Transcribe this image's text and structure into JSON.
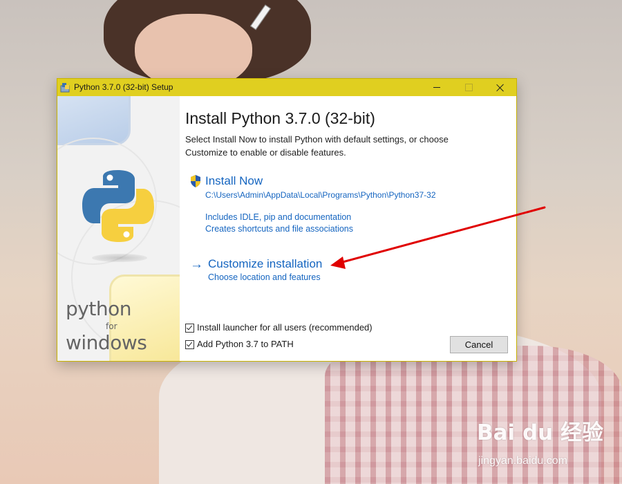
{
  "window": {
    "title": "Python 3.7.0 (32-bit) Setup"
  },
  "sidebar": {
    "brand_python": "python",
    "brand_for": "for",
    "brand_windows": "windows"
  },
  "main": {
    "heading": "Install Python 3.7.0 (32-bit)",
    "subtext_line1": "Select Install Now to install Python with default settings, or choose",
    "subtext_line2": "Customize to enable or disable features."
  },
  "install_now": {
    "label": "Install Now",
    "path": "C:\\Users\\Admin\\AppData\\Local\\Programs\\Python\\Python37-32",
    "detail1": "Includes IDLE, pip and documentation",
    "detail2": "Creates shortcuts and file associations"
  },
  "customize": {
    "label": "Customize installation",
    "detail": "Choose location and features"
  },
  "options": {
    "launcher_label": "Install launcher for all users (recommended)",
    "launcher_checked": true,
    "path_label": "Add Python 3.7 to PATH",
    "path_checked": true
  },
  "buttons": {
    "cancel": "Cancel"
  },
  "watermark": {
    "logo": "Bai du 经验",
    "url": "jingyan.baidu.com"
  },
  "colors": {
    "titlebar": "#e0cf20",
    "link": "#1565c0",
    "annotation_arrow": "#e00000"
  }
}
